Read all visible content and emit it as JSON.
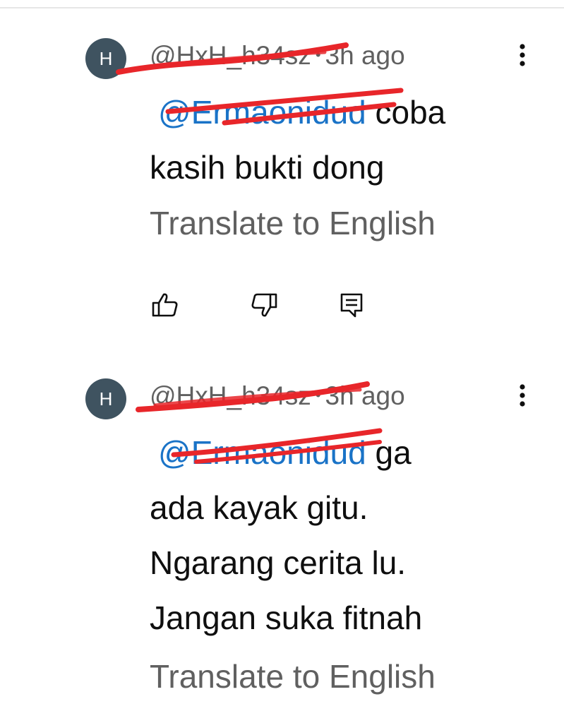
{
  "comments": [
    {
      "avatar_letter": "H",
      "handle": "@HxH_h34sz",
      "separator": "•",
      "time": "3h ago",
      "mention": "@Ermaonidud",
      "lines": [
        "coba",
        "kasih bukti dong"
      ],
      "translate_label": "Translate to English",
      "actions": [
        "thumbs-up-icon",
        "thumbs-down-icon",
        "reply-icon"
      ]
    },
    {
      "avatar_letter": "H",
      "handle": "@HxH_h34sz",
      "separator": "•",
      "time": "3h ago",
      "mention": "@Ermaonidud",
      "lines": [
        "ga",
        "ada kayak gitu.",
        "Ngarang cerita lu.",
        "Jangan suka fitnah"
      ],
      "translate_label": "Translate to English"
    }
  ],
  "colors": {
    "avatar_bg": "#3f5360",
    "mention": "#1a73c7",
    "secondary_text": "#606060",
    "primary_text": "#0f0f0f",
    "redaction": "#e8262a"
  }
}
